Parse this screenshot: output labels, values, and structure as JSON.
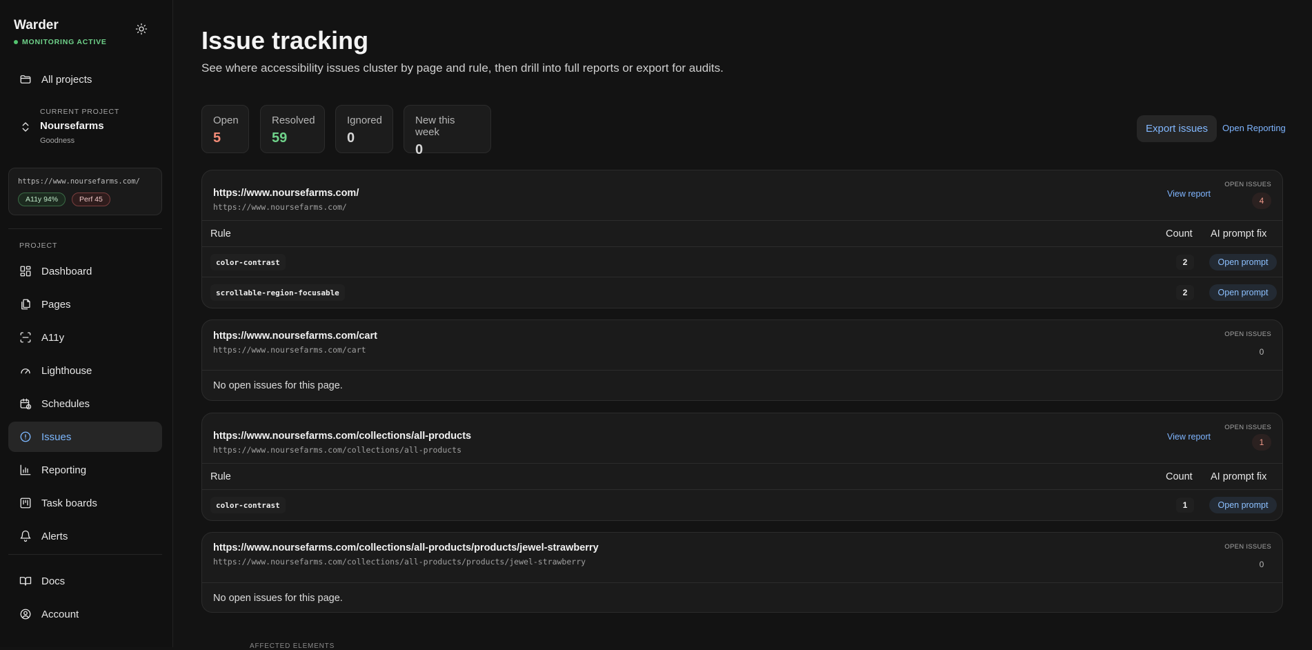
{
  "brand": {
    "name": "Warder",
    "status": "MONITORING ACTIVE"
  },
  "sidebar": {
    "all_projects": "All projects",
    "current_project": {
      "label": "CURRENT PROJECT",
      "name": "Noursefarms",
      "sub": "Goodness"
    },
    "site_card": {
      "url": "https://www.noursefarms.com/",
      "a11y_badge": "A11y 94%",
      "perf_badge": "Perf 45"
    },
    "section_label": "PROJECT",
    "items": [
      {
        "label": "Dashboard",
        "icon": "dashboard-icon"
      },
      {
        "label": "Pages",
        "icon": "pages-icon"
      },
      {
        "label": "A11y",
        "icon": "a11y-icon"
      },
      {
        "label": "Lighthouse",
        "icon": "lighthouse-icon"
      },
      {
        "label": "Schedules",
        "icon": "schedules-icon"
      },
      {
        "label": "Issues",
        "icon": "issues-icon",
        "active": true
      },
      {
        "label": "Reporting",
        "icon": "reporting-icon"
      },
      {
        "label": "Task boards",
        "icon": "task-boards-icon"
      },
      {
        "label": "Alerts",
        "icon": "alerts-icon"
      }
    ],
    "footer_items": [
      {
        "label": "Docs",
        "icon": "docs-icon"
      },
      {
        "label": "Account",
        "icon": "account-icon"
      }
    ]
  },
  "header": {
    "title": "Issue tracking",
    "subtitle": "See where accessibility issues cluster by page and rule, then drill into full reports or export for audits."
  },
  "stats": [
    {
      "label": "Open",
      "value": "5",
      "color": "#f28b77"
    },
    {
      "label": "Resolved",
      "value": "59",
      "color": "#6fd28a"
    },
    {
      "label": "Ignored",
      "value": "0",
      "color": "#d6d6d6"
    },
    {
      "label": "New this week",
      "value": "0",
      "color": "#d6d6d6"
    }
  ],
  "actions": {
    "export": "Export issues",
    "open_reporting": "Open Reporting"
  },
  "table_headers": {
    "rule": "Rule",
    "count": "Count",
    "ai": "AI prompt fix"
  },
  "open_issues_label": "OPEN ISSUES",
  "view_report_label": "View report",
  "open_prompt_label": "Open prompt",
  "no_issues_text": "No open issues for this page.",
  "pages": [
    {
      "title": "https://www.noursefarms.com/",
      "url": "https://www.noursefarms.com/",
      "open_issues": "4",
      "rules": [
        {
          "rule": "color-contrast",
          "count": "2"
        },
        {
          "rule": "scrollable-region-focusable",
          "count": "2"
        }
      ]
    },
    {
      "title": "https://www.noursefarms.com/cart",
      "url": "https://www.noursefarms.com/cart",
      "open_issues": "0",
      "rules": []
    },
    {
      "title": "https://www.noursefarms.com/collections/all-products",
      "url": "https://www.noursefarms.com/collections/all-products",
      "open_issues": "1",
      "rules": [
        {
          "rule": "color-contrast",
          "count": "1"
        }
      ]
    },
    {
      "title": "https://www.noursefarms.com/collections/all-products/products/jewel-strawberry",
      "url": "https://www.noursefarms.com/collections/all-products/products/jewel-strawberry",
      "open_issues": "0",
      "rules": []
    }
  ],
  "below_fold_label": "AFFECTED ELEMENTS"
}
